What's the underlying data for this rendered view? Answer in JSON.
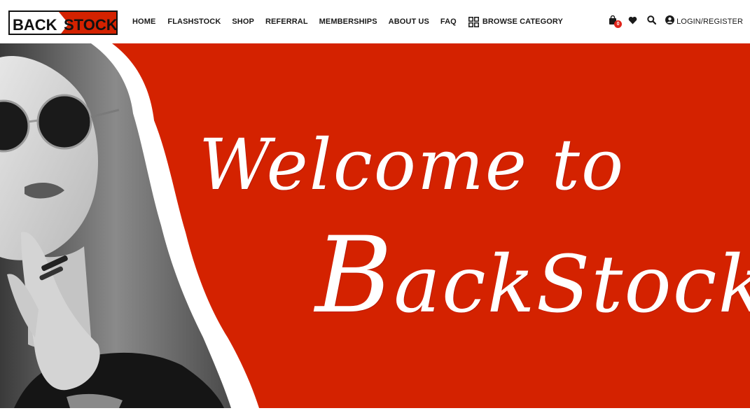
{
  "brand": {
    "logo_part1": "BACK",
    "logo_part2": "STOCK",
    "primary_color": "#d42200",
    "dark_color": "#111111"
  },
  "nav": {
    "items": [
      {
        "label": "HOME"
      },
      {
        "label": "FLASHSTOCK"
      },
      {
        "label": "SHOP"
      },
      {
        "label": "REFERRAL"
      },
      {
        "label": "MEMBERSHIPS"
      },
      {
        "label": "ABOUT US"
      },
      {
        "label": "FAQ"
      }
    ],
    "browse_label": "BROWSE CATEGORY",
    "browse_icon": "grid-icon"
  },
  "tools": {
    "cart_icon": "shopping-bag-icon",
    "cart_count": "0",
    "wishlist_icon": "heart-icon",
    "search_icon": "search-icon",
    "account_icon": "user-circle-icon",
    "login_label": "LOGIN/REGISTER"
  },
  "hero": {
    "title_line1": "Welcome to",
    "title_line2_first": "B",
    "title_line2_rest": "ackStock",
    "background_color": "#d42200"
  }
}
